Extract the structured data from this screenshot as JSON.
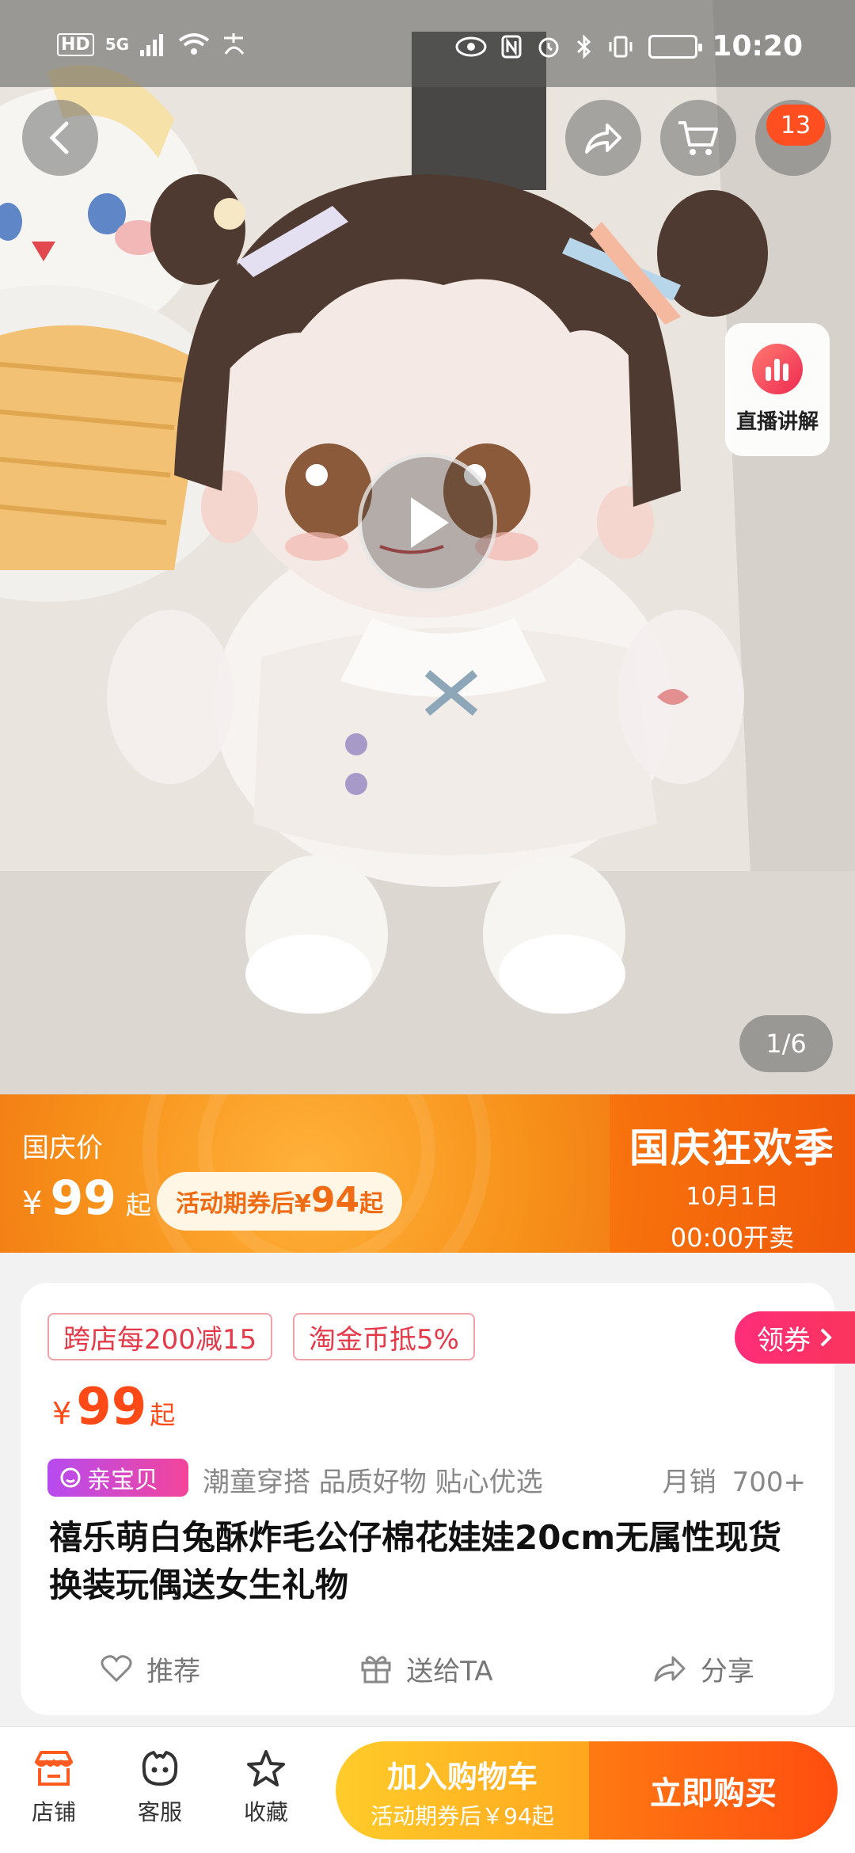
{
  "status_bar": {
    "network_left": "HD",
    "network_type": "5G",
    "time": "10:20"
  },
  "product_gallery": {
    "page_indicator": "1/6",
    "cart_count": "13",
    "live_label": "直播讲解"
  },
  "promo_banner": {
    "label": "国庆价",
    "currency": "¥",
    "price": "99",
    "price_suffix": "起",
    "coupon_pill_prefix": "活动期券后",
    "coupon_pill_currency": "¥",
    "coupon_pill_price": "94",
    "coupon_pill_suffix": "起",
    "event_title": "国庆狂欢季",
    "event_date": "10月1日",
    "event_time": "00:00开卖"
  },
  "info_card": {
    "tags": [
      "跨店每200减15",
      "淘金币抵5%"
    ],
    "coupon_button": "领券",
    "currency": "¥",
    "price": "99",
    "price_suffix": "起",
    "pet_badge": "亲宝贝",
    "slogan": "潮童穿搭 品质好物 贴心优选",
    "sales_label": "月销",
    "sales_value": "700+",
    "title": "禧乐萌白兔酥炸毛公仔棉花娃娃20cm无属性现货换装玩偶送女生礼物",
    "actions": {
      "recommend": "推荐",
      "gift": "送给TA",
      "share": "分享"
    }
  },
  "bottom_bar": {
    "shop": "店铺",
    "service": "客服",
    "favorite": "收藏",
    "add_to_cart": "加入购物车",
    "add_to_cart_sub": "活动期券后￥94起",
    "buy_now": "立即购买"
  },
  "colors": {
    "accent_orange": "#ff4a17",
    "promo_orange": "#f7911a",
    "tag_red": "#e43a4a",
    "cart_yellow": "#ffcc2a",
    "buy_orange": "#ff4d10"
  },
  "icons": {
    "back": "chevron-left-icon",
    "share": "share-arrow-icon",
    "cart": "cart-icon",
    "more": "more-icon",
    "live": "live-chart-icon",
    "play": "play-icon",
    "heart": "heart-icon",
    "gift": "gift-icon",
    "shop": "shop-icon",
    "service": "service-face-icon",
    "star": "star-icon"
  }
}
